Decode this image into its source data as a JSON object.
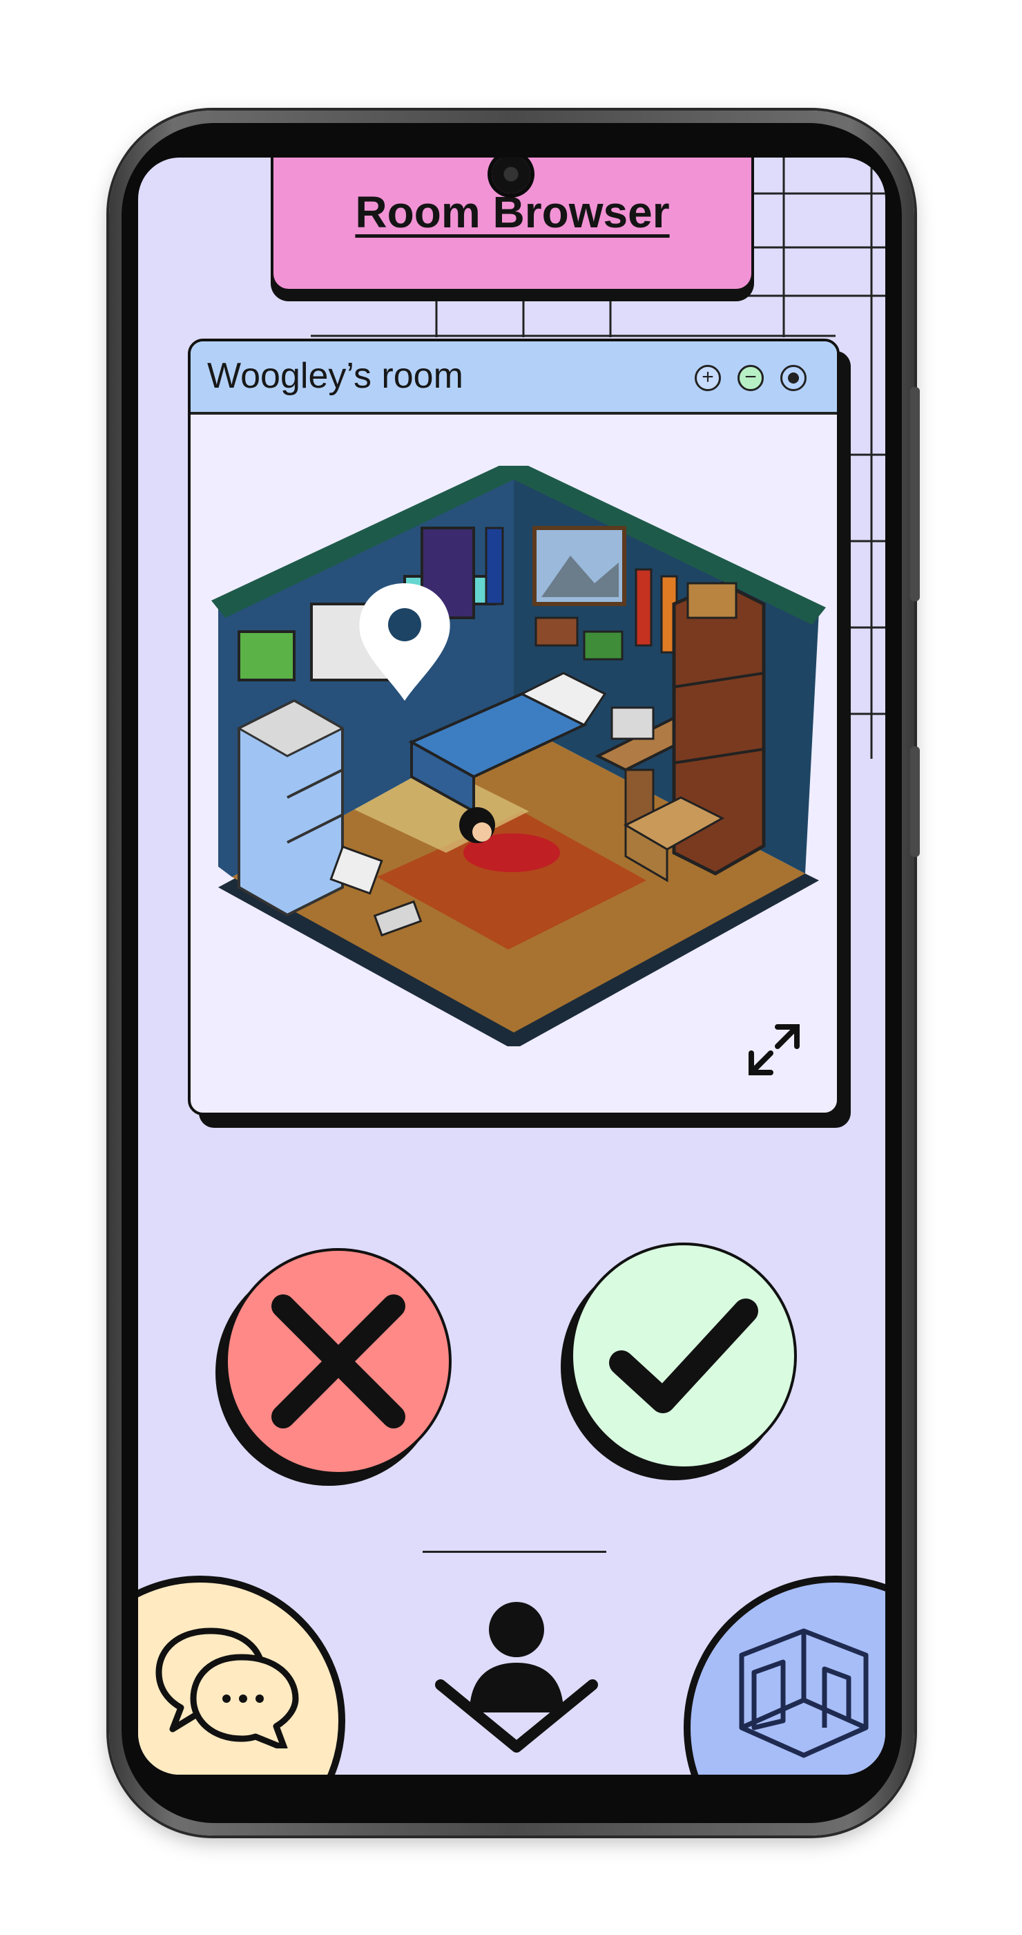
{
  "header": {
    "title": "Room Browser"
  },
  "room_window": {
    "title": "Woogley’s room",
    "controls": [
      "zoom-in-icon",
      "minimize-icon",
      "radio-icon"
    ]
  },
  "actions": {
    "reject_icon": "close-x-icon",
    "accept_icon": "checkmark-icon"
  },
  "bottom_nav": {
    "items": [
      "chat-bubbles-icon",
      "profile-icon",
      "room-cube-icon"
    ]
  },
  "colors": {
    "screen_bg": "#dedcfa",
    "title_tab": "#f293d5",
    "window_bar": "#b3d1f8",
    "reject": "#fe8986",
    "accept": "#d9fbe0",
    "chat": "#ffeac1",
    "rooms": "#a7bdf7"
  }
}
